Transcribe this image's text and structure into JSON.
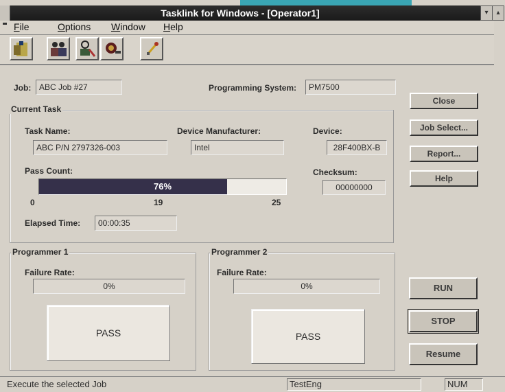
{
  "window": {
    "title": "Tasklink for Windows - [Operator1]"
  },
  "menu": [
    "File",
    "Options",
    "Window",
    "Help"
  ],
  "toolbar": {
    "icons": [
      "job-open-icon",
      "operators-icon",
      "user-settings-icon",
      "programmer-icon",
      "tool-icon"
    ]
  },
  "job": {
    "label": "Job:",
    "value": "ABC Job #27",
    "prog_label": "Programming System:",
    "prog_value": "PM7500"
  },
  "current_task": {
    "title": "Current Task",
    "task_name_label": "Task Name:",
    "task_name": "ABC P/N 2797326-003",
    "manufacturer_label": "Device Manufacturer:",
    "manufacturer": "Intel",
    "device_label": "Device:",
    "device": "28F400BX-B",
    "pass_count_label": "Pass Count:",
    "progress_percent": 76,
    "progress_text": "76%",
    "scale_min": "0",
    "scale_mid": "19",
    "scale_max": "25",
    "checksum_label": "Checksum:",
    "checksum": "00000000",
    "elapsed_label": "Elapsed Time:",
    "elapsed": "00:00:35"
  },
  "programmer1": {
    "title": "Programmer 1",
    "failure_label": "Failure Rate:",
    "failure_rate": "0%",
    "result": "PASS"
  },
  "programmer2": {
    "title": "Programmer 2",
    "failure_label": "Failure Rate:",
    "failure_rate": "0%",
    "result": "PASS"
  },
  "buttons": {
    "close": "Close",
    "job_select": "Job Select...",
    "report": "Report...",
    "help": "Help",
    "run": "RUN",
    "stop": "STOP",
    "resume": "Resume"
  },
  "status": {
    "message": "Execute the selected Job",
    "user": "TestEng",
    "num": "NUM"
  }
}
